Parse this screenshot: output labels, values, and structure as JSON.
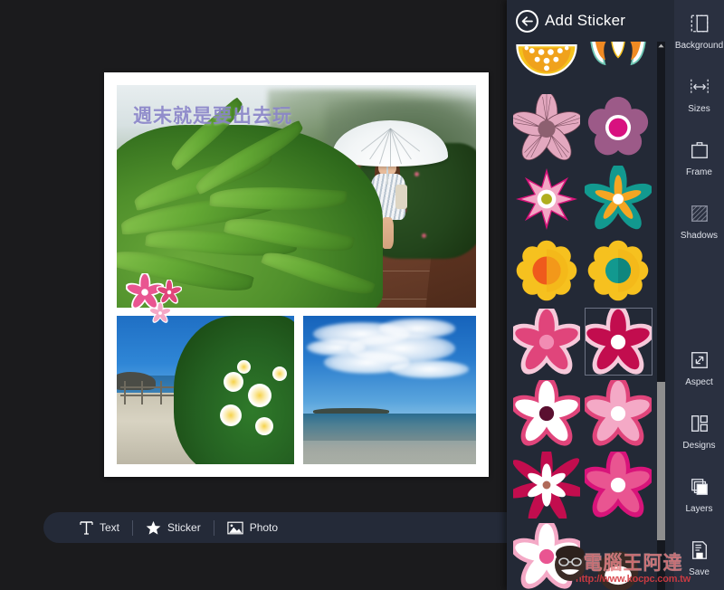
{
  "app": {
    "background_color": "#1b1b1d",
    "panel_color": "#232936",
    "sidebar_color": "#2a3040",
    "accent_color": "#e0457b"
  },
  "canvas": {
    "caption_text": "週末就是要出去玩",
    "caption_color": "#8b86c9",
    "photos": [
      {
        "name": "photo-hero",
        "alt": "Woman with white umbrella on a wet boardwalk among green leaves"
      },
      {
        "name": "photo-left",
        "alt": "White plumeria flowers beside a seaside path"
      },
      {
        "name": "photo-right",
        "alt": "Beach shoreline under a wide blue cloudy sky"
      }
    ],
    "placed_stickers": [
      {
        "name": "placed-flower-large",
        "color": "#e95591"
      },
      {
        "name": "placed-flower-medium",
        "color": "#e0457b"
      },
      {
        "name": "placed-flower-small",
        "color": "#f5a8c6"
      }
    ]
  },
  "bottom_toolbar": {
    "items": [
      {
        "label": "Text",
        "icon": "text-icon"
      },
      {
        "label": "Sticker",
        "icon": "star-icon"
      },
      {
        "label": "Photo",
        "icon": "image-icon"
      }
    ]
  },
  "sticker_panel": {
    "title": "Add Sticker",
    "back_icon": "back-arrow-icon",
    "scrollbar": {
      "position_percent": 62
    },
    "stickers": [
      {
        "name": "sticker-yellow-dotted-dome",
        "type": "dome",
        "colors": [
          "#f4c21e",
          "#f0a21c",
          "#ffffff"
        ]
      },
      {
        "name": "sticker-orange-white-bloom",
        "type": "bloom",
        "colors": [
          "#f08a22",
          "#ffffff",
          "#6ec7b4"
        ]
      },
      {
        "name": "sticker-mauve-sketch-flower",
        "type": "sketch",
        "colors": [
          "#e3a8bf",
          "#7e5463",
          "#8d6070"
        ]
      },
      {
        "name": "sticker-plum-magenta-flower",
        "type": "ring",
        "colors": [
          "#9c5a88",
          "#ffffff",
          "#d8117f"
        ]
      },
      {
        "name": "sticker-pink-star-flower",
        "type": "star8",
        "colors": [
          "#d8147a",
          "#f2a6c4",
          "#ffffff",
          "#b0ae1e"
        ]
      },
      {
        "name": "sticker-teal-orange-flower",
        "type": "pinwheel",
        "colors": [
          "#12998f",
          "#f5a623",
          "#ffffff"
        ]
      },
      {
        "name": "sticker-yellow-orange-daisy",
        "type": "daisy",
        "colors": [
          "#f6c11f",
          "#ef5a1c",
          "#f47920"
        ]
      },
      {
        "name": "sticker-yellow-teal-daisy",
        "type": "daisy",
        "colors": [
          "#f6c11f",
          "#12998f",
          "#f3b316"
        ]
      },
      {
        "name": "sticker-pink-layered-blossom",
        "type": "blossom",
        "colors": [
          "#f6c9da",
          "#e0457b",
          "#f28cb3"
        ]
      },
      {
        "name": "sticker-crimson-white-blossom",
        "type": "blossom",
        "colors": [
          "#f6c9da",
          "#c20d4e",
          "#ffffff"
        ],
        "selected": true
      },
      {
        "name": "sticker-white-dark-center-blossom",
        "type": "blossom",
        "colors": [
          "#e0457b",
          "#ffffff",
          "#5a1030"
        ]
      },
      {
        "name": "sticker-lightpink-white-blossom",
        "type": "blossom",
        "colors": [
          "#e0457b",
          "#f4a9c6",
          "#ffffff"
        ]
      },
      {
        "name": "sticker-crimson-spiky-flower",
        "type": "spiky",
        "colors": [
          "#c20d4e",
          "#ffffff",
          "#b06a5a"
        ]
      },
      {
        "name": "sticker-rose-white-center-blossom",
        "type": "blossom",
        "colors": [
          "#d8147a",
          "#e95591",
          "#ffffff"
        ]
      },
      {
        "name": "sticker-pale-pink-blossom",
        "type": "blossom",
        "colors": [
          "#f4a9c6",
          "#ffffff",
          "#e95591"
        ]
      },
      {
        "name": "sticker-face-partial",
        "type": "face",
        "colors": [
          "#3a2a24",
          "#c9a28a"
        ]
      }
    ]
  },
  "sidebar": {
    "items": [
      {
        "label": "Background",
        "icon": "background-icon"
      },
      {
        "label": "Sizes",
        "icon": "sizes-icon"
      },
      {
        "label": "Frame",
        "icon": "frame-icon"
      },
      {
        "label": "Shadows",
        "icon": "shadows-icon"
      },
      {
        "label": "Aspect",
        "icon": "aspect-icon"
      },
      {
        "label": "Designs",
        "icon": "designs-icon"
      },
      {
        "label": "Layers",
        "icon": "layers-icon"
      },
      {
        "label": "Save",
        "icon": "save-icon"
      }
    ]
  },
  "watermark": {
    "text": "電腦王阿達",
    "url": "http://www.kocpc.com.tw"
  }
}
